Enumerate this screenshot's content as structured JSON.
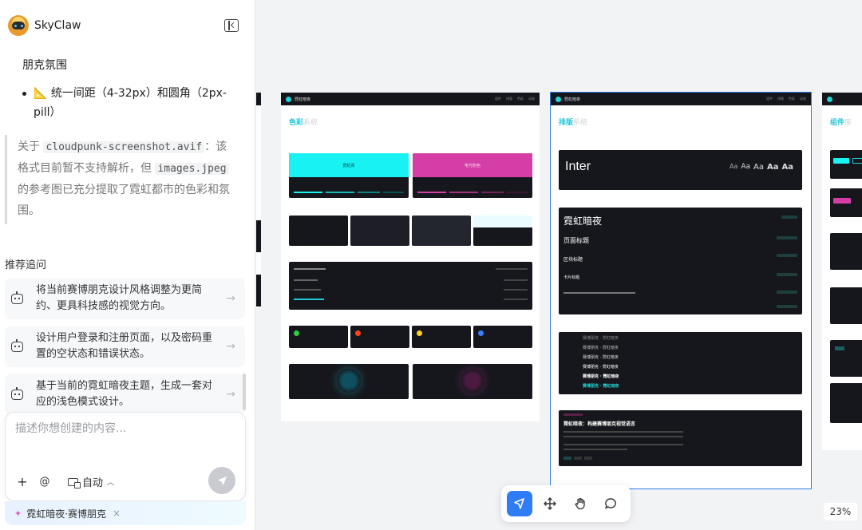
{
  "app": {
    "name": "SkyClaw"
  },
  "chat": {
    "line1": "朋克氛围",
    "bullet": "📐 统一间距（4-32px）和圆角（2px-pill）",
    "quote": {
      "pre": "关于 ",
      "code1": "cloudpunk-screenshot.avif",
      "mid": "：该格式目前暂不支持解析，但 ",
      "code2": "images.jpeg",
      "post": " 的参考图已充分提取了霓虹都市的色彩和氛围。"
    }
  },
  "suggestions": {
    "title": "推荐追问",
    "items": [
      {
        "text": "将当前赛博朋克设计风格调整为更简约、更具科技感的视觉方向。"
      },
      {
        "text": "设计用户登录和注册页面，以及密码重置的空状态和错误状态。"
      },
      {
        "text": "基于当前的霓虹暗夜主题，生成一套对应的浅色模式设计。"
      }
    ]
  },
  "composer": {
    "placeholder": "描述你想创建的内容...",
    "plus": "+",
    "at": "@",
    "mode": "自动",
    "context_tag": "霓虹暗夜·赛博朋克",
    "tag_close": "×"
  },
  "frames": {
    "colors": {
      "nav_title": "霓虹暗夜",
      "nav_links": [
        "组件",
        "排版",
        "色彩",
        "动效"
      ],
      "title_accent": "色彩",
      "title_rest": "系统",
      "swatch_cyan": "霓虹青",
      "swatch_pink": "电光粉色"
    },
    "typography": {
      "nav_title": "霓虹暗夜",
      "title_accent": "排版",
      "title_rest": "系统",
      "font_name": "Inter",
      "aa_samples": [
        "Aa",
        "Aa",
        "Aa",
        "Aa",
        "Aa"
      ],
      "heading1": "霓虹暗夜",
      "heading2": "页面标题",
      "heading3": "区块标题",
      "heading4": "卡片标题",
      "type_list": [
        "赛博朋克 · 霓虹暗夜",
        "赛博朋克 · 霓虹暗夜",
        "赛博朋克 · 霓虹暗夜",
        "赛博朋克 · 霓虹暗夜",
        "赛博朋克 · 霓虹暗夜",
        "赛博朋克 · 霓虹暗夜"
      ],
      "article_title": "霓虹暗夜：构建赛博朋克视觉语言"
    },
    "components": {
      "title_accent": "组件",
      "title_rest": "库"
    }
  },
  "toolbar": {
    "tools": [
      "select-tool",
      "move-tool",
      "hand-tool",
      "comment-tool"
    ]
  },
  "zoom": {
    "value": "23%"
  },
  "colors": {
    "accent": "#2e7cf6",
    "neon_cyan": "#19f2f2",
    "neon_pink": "#d43ea6"
  }
}
